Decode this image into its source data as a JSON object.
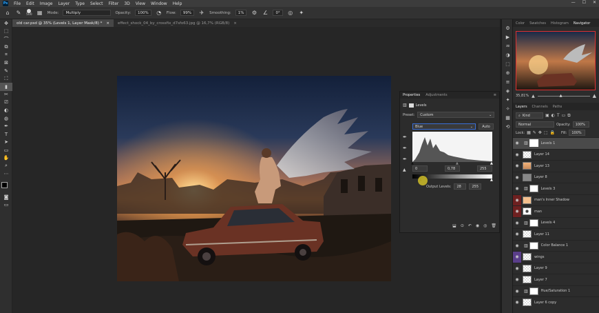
{
  "app": {
    "logo": "Ps"
  },
  "menu": [
    "File",
    "Edit",
    "Image",
    "Layer",
    "Type",
    "Select",
    "Filter",
    "3D",
    "View",
    "Window",
    "Help"
  ],
  "window_controls": [
    "—",
    "☐",
    "✕"
  ],
  "options_bar": {
    "brush_size": "500",
    "mode_label": "Mode:",
    "mode_value": "Multiply",
    "opacity_label": "Opacity:",
    "opacity_value": "100%",
    "flow_label": "Flow:",
    "flow_value": "99%",
    "smoothing_label": "Smoothing:",
    "smoothing_value": "1%",
    "angle_value": "0°"
  },
  "tabs": [
    {
      "label": "old car.psd @ 35% (Levels 1, Layer Mask/8) *",
      "close": "×",
      "active": true
    },
    {
      "label": "effect_shock_04_by_crossfix_d7sfo63.jpg @ 16,7% (RGB/8)",
      "close": "×",
      "active": false
    }
  ],
  "tools": [
    "✥",
    "⬚",
    "⌒",
    "⧉",
    "⌗",
    "⊠",
    "✎",
    "⛶",
    "▮",
    "✂",
    "⎚",
    "◐",
    "◍",
    "✒",
    "T",
    "➤",
    "▭",
    "✋",
    "⌕",
    "⋯"
  ],
  "properties": {
    "tab_active": "Properties",
    "tab_other": "Adjustments",
    "type_label": "Levels",
    "preset_label": "Preset:",
    "preset_value": "Custom",
    "channel_value": "Blue",
    "auto_label": "Auto",
    "input_black": "0",
    "input_gamma": "0,78",
    "input_white": "255",
    "output_label": "Output Levels:",
    "output_black": "28",
    "output_white": "255",
    "footer_icons": [
      "⬓",
      "⊙",
      "↶",
      "◉",
      "◎",
      "🗑"
    ]
  },
  "right_strip_icons": [
    "⚙",
    "▶",
    "♒",
    "◑",
    "⬚",
    "⊕",
    "≡",
    "◈",
    "✦",
    "✧",
    "▦",
    "⟲"
  ],
  "navigator": {
    "tabs": [
      {
        "label": "Color",
        "active": false
      },
      {
        "label": "Swatches",
        "active": false
      },
      {
        "label": "Histogram",
        "active": false
      },
      {
        "label": "Navigator",
        "active": true
      }
    ],
    "zoom": "35,81%"
  },
  "layers_panel": {
    "tabs": [
      {
        "label": "Layers",
        "active": true
      },
      {
        "label": "Channels",
        "active": false
      },
      {
        "label": "Paths",
        "active": false
      }
    ],
    "kind_label": "Kind",
    "blend_mode": "Normal",
    "opacity_label": "Opacity:",
    "opacity_value": "100%",
    "lock_label": "Lock:",
    "fill_label": "Fill:",
    "fill_value": "100%",
    "layers": [
      {
        "name": "Levels 1",
        "thumb": "mask",
        "selected": true,
        "vis": "normal"
      },
      {
        "name": "Layer 14",
        "thumb": "checker",
        "vis": "normal"
      },
      {
        "name": "Layer 13",
        "thumb": "warm",
        "vis": "normal"
      },
      {
        "name": "Layer 8",
        "thumb": "gray",
        "vis": "normal"
      },
      {
        "name": "Levels 3",
        "thumb": "mask",
        "vis": "normal"
      },
      {
        "name": "man's Inner Shadow",
        "thumb": "peach",
        "vis": "red"
      },
      {
        "name": "man",
        "thumb": "man",
        "vis": "red"
      },
      {
        "name": "Levels 4",
        "thumb": "mask",
        "vis": "normal"
      },
      {
        "name": "Layer 11",
        "thumb": "checker",
        "vis": "normal"
      },
      {
        "name": "Color Balance 1",
        "thumb": "mask",
        "vis": "normal"
      },
      {
        "name": "wings",
        "thumb": "checker",
        "vis": "purple"
      },
      {
        "name": "Layer 9",
        "thumb": "checker",
        "vis": "normal"
      },
      {
        "name": "Layer 7",
        "thumb": "checker",
        "vis": "normal"
      },
      {
        "name": "Hue/Saturation 1",
        "thumb": "mask",
        "vis": "normal"
      },
      {
        "name": "Layer 6 copy",
        "thumb": "checker",
        "vis": "normal"
      }
    ]
  }
}
